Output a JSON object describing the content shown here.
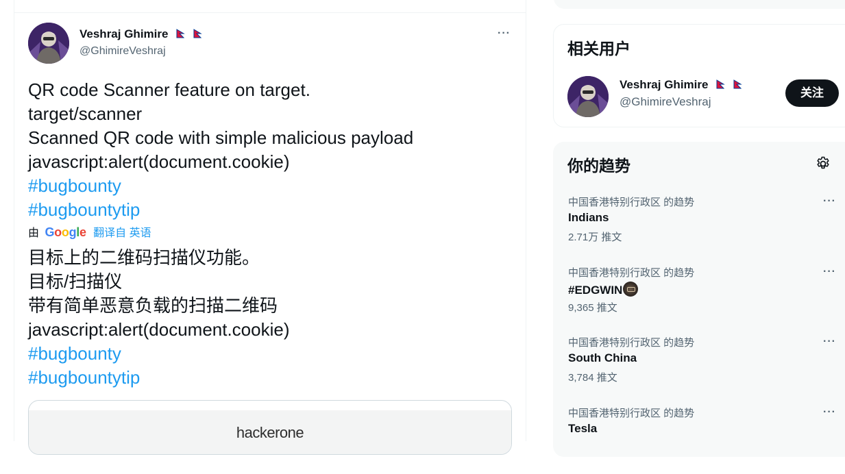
{
  "tweet": {
    "author_name": "Veshraj Ghimire",
    "author_handle": "@GhimireVeshraj",
    "more_label": "···",
    "text_lines": [
      "QR code Scanner feature on target.",
      "target/scanner",
      "Scanned QR code with simple malicious payload",
      "javascript:alert(document.cookie)"
    ],
    "hashtags": [
      "#bugbounty",
      "#bugbountytip"
    ],
    "translation": {
      "by_label": "由",
      "google_logo": "Google",
      "link_label": "翻译自 英语",
      "text_lines": [
        "目标上的二维码扫描仪功能。",
        "目标/扫描仪",
        "带有简单恶意负载的扫描二维码",
        "javascript:alert(document.cookie)"
      ],
      "hashtags": [
        "#bugbounty",
        "#bugbountytip"
      ]
    },
    "card_logo_text": "hackerone"
  },
  "related_users": {
    "title": "相关用户",
    "user": {
      "name": "Veshraj Ghimire",
      "handle": "@GhimireVeshraj",
      "follow_label": "关注"
    }
  },
  "trends": {
    "title": "你的趋势",
    "settings_icon": "gear-icon",
    "more_label": "···",
    "items": [
      {
        "context": "中国香港特别行政区 的趋势",
        "name": "Indians",
        "count": "2.71万 推文"
      },
      {
        "context": "中国香港特别行政区 的趋势",
        "name": "#EDGWIN",
        "count": "9,365 推文"
      },
      {
        "context": "中国香港特别行政区 的趋势",
        "name": "South China",
        "count": "3,784 推文"
      },
      {
        "context": "中国香港特别行政区 的趋势",
        "name": "Tesla",
        "count": ""
      }
    ]
  },
  "colors": {
    "link": "#1d9bf0",
    "secondary_text": "#536471",
    "primary_text": "#0f1419",
    "follow_button": "#0f1419",
    "flag_red": "#dc143c",
    "flag_blue": "#003893"
  }
}
